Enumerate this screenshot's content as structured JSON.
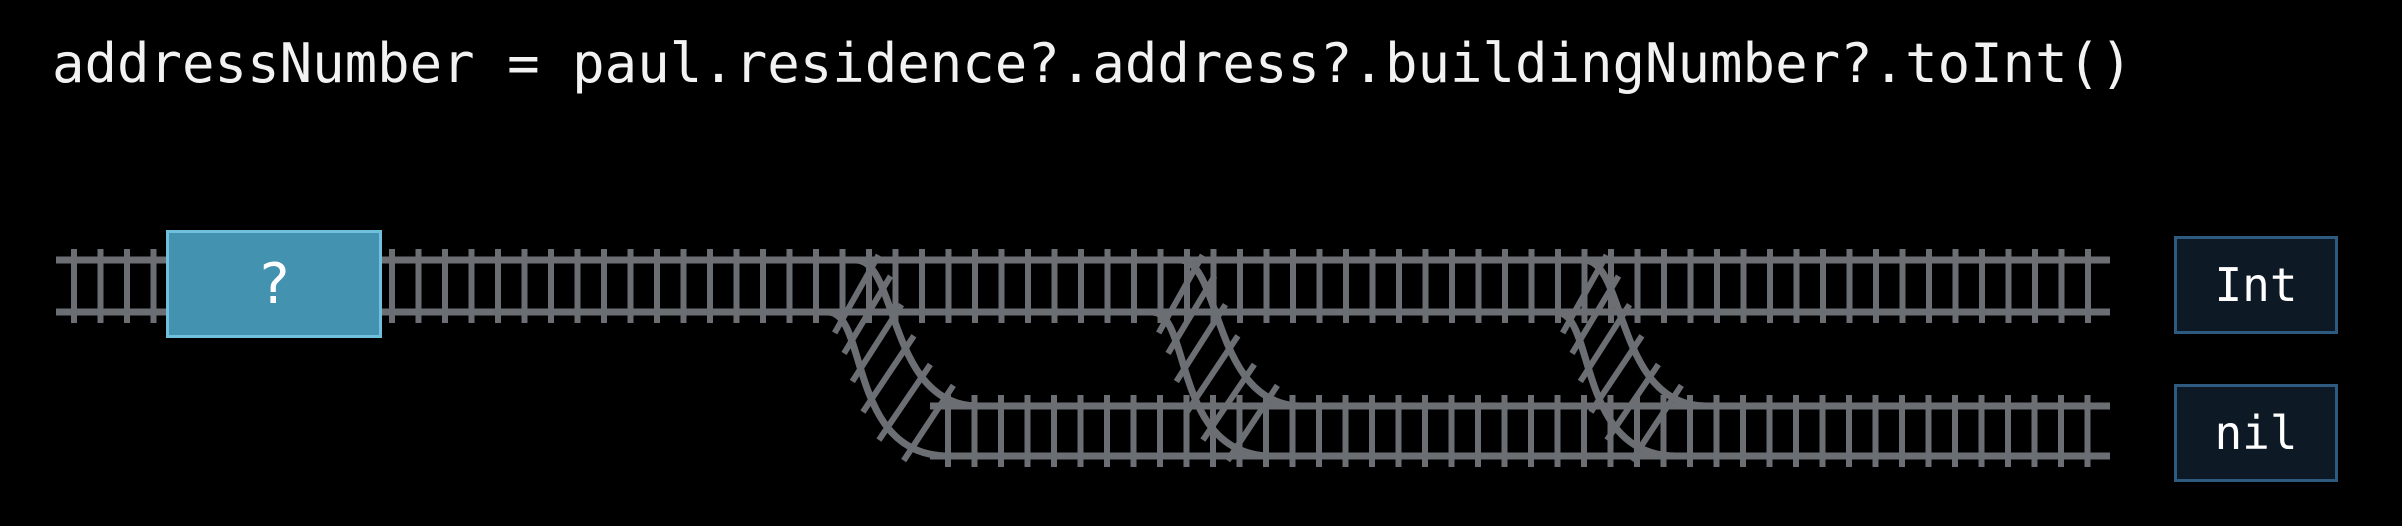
{
  "code": {
    "expression": "addressNumber = paul.residence?.address?.buildingNumber?.toInt()"
  },
  "train": {
    "label": "?"
  },
  "results": {
    "success_label": "Int",
    "failure_label": "nil"
  },
  "colors": {
    "background": "#000000",
    "track": "#6b6e73",
    "train_fill": "#4292b0",
    "train_border": "#6fc0dd",
    "result_fill": "#0d1a26",
    "result_border": "#2f5a7f",
    "text": "#f2f2f2"
  }
}
